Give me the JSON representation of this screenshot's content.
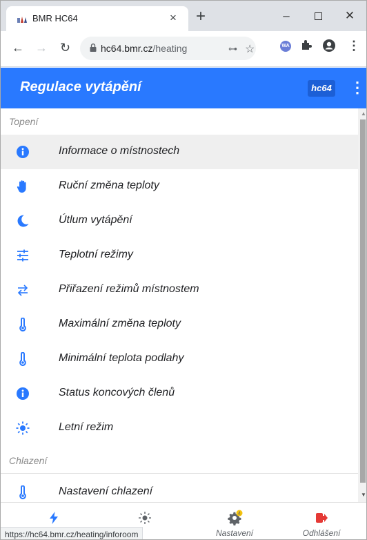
{
  "browser": {
    "tab_title": "BMR HC64",
    "url_host": "hc64.bmr.cz",
    "url_path": "/heating",
    "extension_wa": "WA",
    "status_url": "https://hc64.bmr.cz/heating/inforoom"
  },
  "app": {
    "title": "Regulace vytápění",
    "badge": "hc64",
    "accent_color": "#2979ff"
  },
  "sections": [
    {
      "header": "Topení",
      "items": [
        {
          "label": "Informace o místnostech",
          "icon": "info-circle-icon",
          "active": true
        },
        {
          "label": "Ruční změna teploty",
          "icon": "hand-icon"
        },
        {
          "label": "Útlum vytápění",
          "icon": "moon-icon"
        },
        {
          "label": "Teplotní režimy",
          "icon": "sliders-icon"
        },
        {
          "label": "Přiřazení režimů místnostem",
          "icon": "swap-arrows-icon"
        },
        {
          "label": "Maximální změna teploty",
          "icon": "thermometer-icon"
        },
        {
          "label": "Minimální teplota podlahy",
          "icon": "thermometer-icon"
        },
        {
          "label": "Status koncových členů",
          "icon": "info-circle-icon"
        },
        {
          "label": "Letní režim",
          "icon": "sun-icon"
        }
      ]
    },
    {
      "header": "Chlazení",
      "items": [
        {
          "label": "Nastavení chlazení",
          "icon": "thermometer-icon"
        }
      ]
    }
  ],
  "bottom_nav": [
    {
      "label": "",
      "icon": "lightning-icon"
    },
    {
      "label": "",
      "icon": "sun-icon"
    },
    {
      "label": "Nastavení",
      "icon": "gear-icon",
      "badge": "4"
    },
    {
      "label": "Odhlášení",
      "icon": "logout-icon"
    }
  ]
}
